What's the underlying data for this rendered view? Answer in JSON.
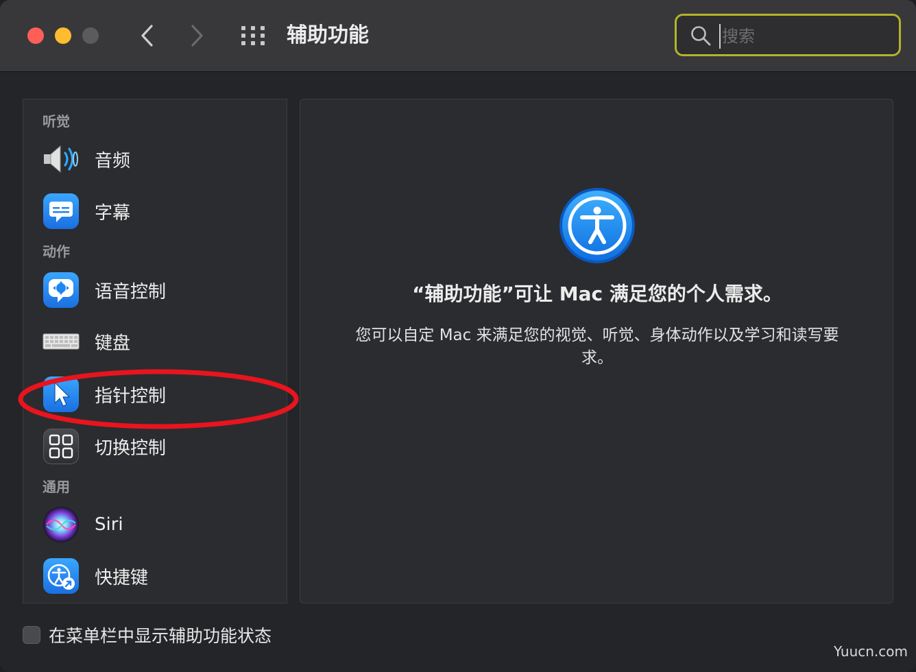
{
  "window": {
    "title": "辅助功能"
  },
  "search": {
    "placeholder": "搜索"
  },
  "sidebar": {
    "sections": [
      {
        "label": "听觉"
      },
      {
        "label": "动作"
      },
      {
        "label": "通用"
      }
    ],
    "items": [
      {
        "label": "音频",
        "icon": "speaker-icon"
      },
      {
        "label": "字幕",
        "icon": "captions-icon"
      },
      {
        "label": "语音控制",
        "icon": "voice-control-icon"
      },
      {
        "label": "键盘",
        "icon": "keyboard-icon"
      },
      {
        "label": "指针控制",
        "icon": "pointer-icon"
      },
      {
        "label": "切换控制",
        "icon": "switch-control-icon"
      },
      {
        "label": "Siri",
        "icon": "siri-icon"
      },
      {
        "label": "快捷键",
        "icon": "accessibility-shortcut-icon"
      }
    ]
  },
  "main": {
    "headline": "“辅助功能”可让 Mac 满足您的个人需求。",
    "description": "您可以自定 Mac 来满足您的视觉、听觉、身体动作以及学习和读写要求。"
  },
  "footer": {
    "checkbox_label": "在菜单栏中显示辅助功能状态",
    "checked": false
  },
  "watermark": "Yuucn.com",
  "colors": {
    "accent": "#1f85f5",
    "annotation": "#e8141e",
    "search_highlight": "#b4b42a"
  }
}
